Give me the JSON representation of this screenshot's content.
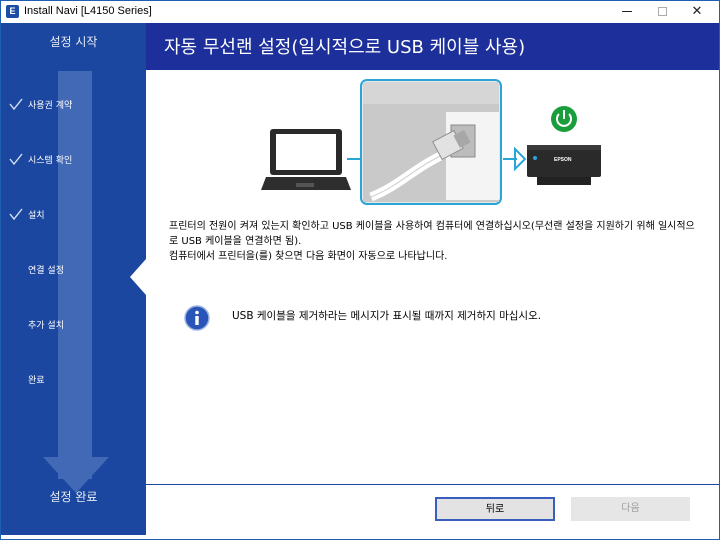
{
  "window": {
    "title": "Install Navi [L4150 Series]",
    "app_icon_letter": "E"
  },
  "sidebar": {
    "start_label": "설정 시작",
    "end_label": "설정 완료",
    "steps": [
      {
        "label": "사용권 계약",
        "done": true
      },
      {
        "label": "시스템 확인",
        "done": true
      },
      {
        "label": "설치",
        "done": true
      },
      {
        "label": "연결 설정",
        "current": true
      },
      {
        "label": "추가 설치"
      },
      {
        "label": "완료"
      }
    ],
    "colors": {
      "background": "#1c47a0",
      "arrow": "#4169b5"
    }
  },
  "header": {
    "title": "자동 무선랜 설정(일시적으로 USB 케이블 사용)",
    "color": "#1c2f9a"
  },
  "illustration": {
    "printer_brand": "EPSON",
    "power_icon": "power-icon"
  },
  "main": {
    "paragraph1": "프린터의 전원이 켜져 있는지 확인하고 USB 케이블을 사용하여 컴퓨터에 연결하십시오(무선랜 설정을 지원하기 위해 일시적으로 USB 케이블을 연결하면 됨).",
    "paragraph2": "컴퓨터에서 프린터을(를) 찾으면 다음 화면이 자동으로 나타납니다.",
    "info_text": "USB 케이블을 제거하라는 메시지가 표시될 때까지 제거하지 마십시오."
  },
  "footer": {
    "back_label": "뒤로",
    "next_label": "다음"
  }
}
